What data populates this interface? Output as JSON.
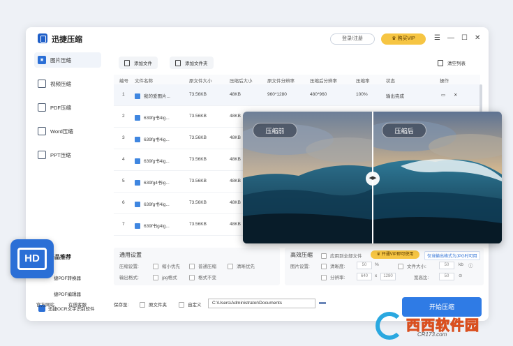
{
  "app": {
    "title": "迅捷压缩",
    "login_label": "登录/注册",
    "vip_label": "购买VIP",
    "window_icons": [
      "menu-icon",
      "minimize-icon",
      "maximize-icon",
      "close-icon"
    ]
  },
  "sidebar": {
    "items": [
      {
        "label": "图片压缩",
        "active": true
      },
      {
        "label": "视频压缩",
        "active": false
      },
      {
        "label": "PDF压缩",
        "active": false
      },
      {
        "label": "Word压缩",
        "active": false
      },
      {
        "label": "PPT压缩",
        "active": false
      }
    ],
    "featured_title": "特色产品推荐",
    "products": [
      "捷PDF转换器",
      "捷PDF编辑器",
      "迅捷OCR文字识别软件"
    ],
    "footer_links": [
      "官方网站",
      "在线客服"
    ]
  },
  "toolbar": {
    "add_file": "添加文件",
    "add_folder": "添加文件夹",
    "clear_list": "清空列表"
  },
  "table": {
    "headers": [
      "编号",
      "文件名称",
      "原文件大小",
      "压缩后大小",
      "原文件分辨率",
      "压缩后分辨率",
      "压缩率",
      "状态",
      "操作"
    ],
    "rows": [
      {
        "no": "1",
        "name": "我的爱图片...",
        "size": "73.56KB",
        "after": "48KB",
        "res": "960*1280",
        "after_res": "480*960",
        "rate": "100%",
        "status": "输出完成"
      },
      {
        "no": "2",
        "name": "639fg书4ig...",
        "size": "73.56KB",
        "after": "48KB"
      },
      {
        "no": "3",
        "name": "639fg书4ig...",
        "size": "73.56KB",
        "after": "48KB"
      },
      {
        "no": "4",
        "name": "639fg书4ig...",
        "size": "73.56KB",
        "after": "48KB"
      },
      {
        "no": "5",
        "name": "639fg4书ig...",
        "size": "73.56KB",
        "after": "48KB"
      },
      {
        "no": "6",
        "name": "639fg书4ig...",
        "size": "73.56KB",
        "after": "48KB"
      },
      {
        "no": "7",
        "name": "639f书g4ig...",
        "size": "73.56KB",
        "after": "48KB"
      }
    ]
  },
  "settings": {
    "title": "通用设置",
    "mode_label": "压缩设置:",
    "modes": [
      "缩小优先",
      "普通压缩",
      "清晰优先"
    ],
    "format_label": "输出格式:",
    "formats": [
      "jpg格式",
      "格式不变"
    ]
  },
  "advanced": {
    "title": "高效压缩",
    "apply_all": "应用到全部文件",
    "vip_badge": "开通VIP即可使用",
    "tip": "仅当输出格式为JPG时可用",
    "quality_label": "图片设置:",
    "clarity": "清晰度:",
    "clarity_value": "50",
    "clarity_unit": "%",
    "filesize": "文件大小:",
    "filesize_value": "50",
    "filesize_unit": "kb",
    "resolution": "分辨率:",
    "res_w": "640",
    "res_x": "x",
    "res_h": "1280",
    "ratio": "宽高比:",
    "ratio_value": "50"
  },
  "save": {
    "label": "保存至:",
    "opt_original": "原文件夹",
    "opt_custom": "自定义",
    "path": "C:\\Users\\Administrator\\Documents",
    "start": "开始压缩"
  },
  "compare": {
    "before": "压缩前",
    "after": "压缩后"
  },
  "badge": {
    "hd": "HD"
  },
  "watermark": {
    "text": "西西软件园",
    "sub": "CR173.com"
  }
}
